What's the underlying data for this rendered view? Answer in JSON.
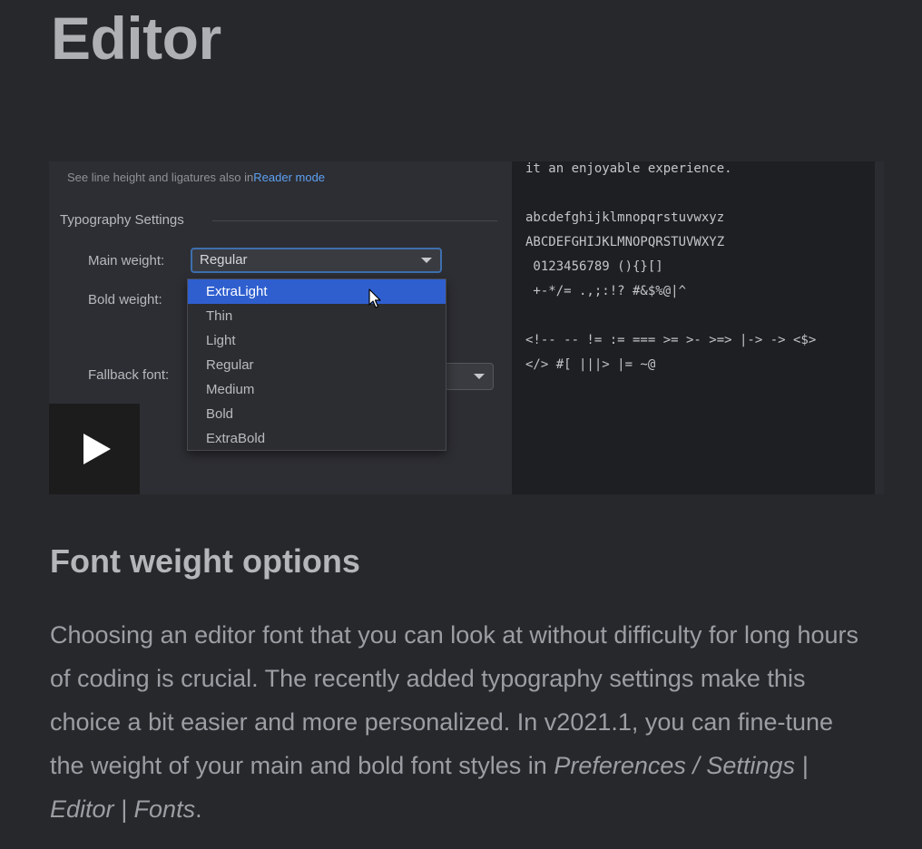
{
  "page": {
    "title": "Editor"
  },
  "settings": {
    "hint_text": "See line height and ligatures also in",
    "hint_link": "Reader mode",
    "section_label": "Typography Settings",
    "main_weight_label": "Main weight:",
    "main_weight_value": "Regular",
    "bold_weight_label": "Bold weight:",
    "fallback_font_label": "Fallback font:",
    "weight_options": [
      "ExtraLight",
      "Thin",
      "Light",
      "Regular",
      "Medium",
      "Bold",
      "ExtraBold"
    ],
    "highlighted_option": "ExtraLight"
  },
  "preview": {
    "lines": [
      "it an enjoyable experience.",
      "abcdefghijklmnopqrstuvwxyz",
      "ABCDEFGHIJKLMNOPQRSTUVWXYZ",
      " 0123456789 (){}[]",
      " +-*/= .,;:!? #&$%@|^",
      "<!-- -- != := === >= >- >=> |-> -> <$>",
      "</> #[ |||> |= ~@"
    ]
  },
  "article": {
    "heading": "Font weight options",
    "body_text": "Choosing an editor font that you can look at without difficulty for long hours of coding is crucial. The recently added typography settings make this choice a bit easier and more personalized. In v2021.1, you can fine-tune the weight of your main and bold font styles in ",
    "body_path": "Preferences / Settings | Editor | Fonts",
    "body_end": "."
  },
  "colors": {
    "background": "#27282c",
    "accent_link": "#5da0f2",
    "selection": "#2f5fcf"
  },
  "icons": {
    "play": "play-icon",
    "dropdown": "chevron-down-icon",
    "cursor": "mouse-pointer-icon"
  }
}
